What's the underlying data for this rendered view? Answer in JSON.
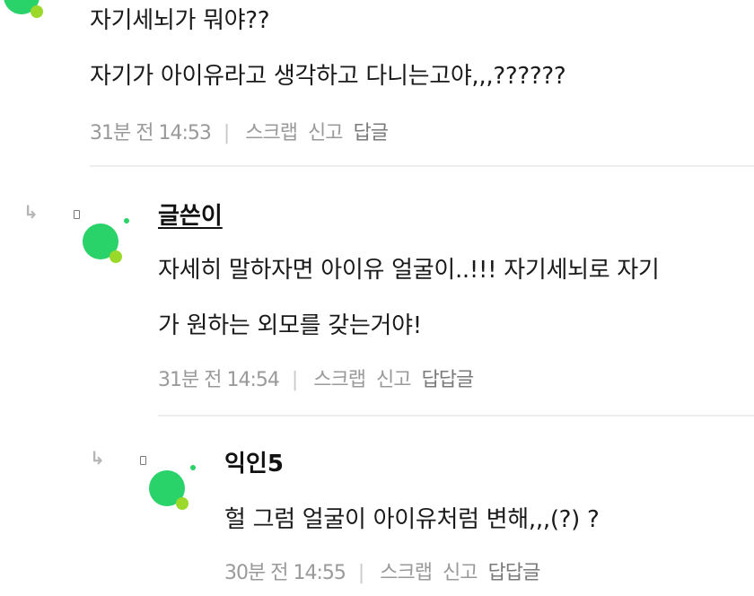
{
  "comments": [
    {
      "lines": [
        "자기세뇌가 뭐야??",
        "자기가 아이유라고 생각하고 다니는고야,,,??????"
      ],
      "time": "31분 전 14:53",
      "separator": "|",
      "actions": [
        "스크랩",
        "신고"
      ],
      "reply_label": "답글"
    },
    {
      "author": "글쓴이",
      "lines": [
        "자세히 말하자면 아이유 얼굴이..!!! 자기세뇌로 자기",
        "가 원하는 외모를 갖는거야!"
      ],
      "time": "31분 전 14:54",
      "separator": "|",
      "actions": [
        "스크랩",
        "신고"
      ],
      "reply_label": "답답글"
    },
    {
      "author": "익인5",
      "lines": [
        "헐 그럼 얼굴이 아이유처럼 변해,,,(?) ?"
      ],
      "time": "30분 전 14:55",
      "separator": "|",
      "actions": [
        "스크랩",
        "신고"
      ],
      "reply_label": "답답글"
    }
  ],
  "icons": {
    "reply_arrow": "↳",
    "avatar_color": "#2ad26a",
    "avatar_accent_color": "#9ad92a"
  }
}
